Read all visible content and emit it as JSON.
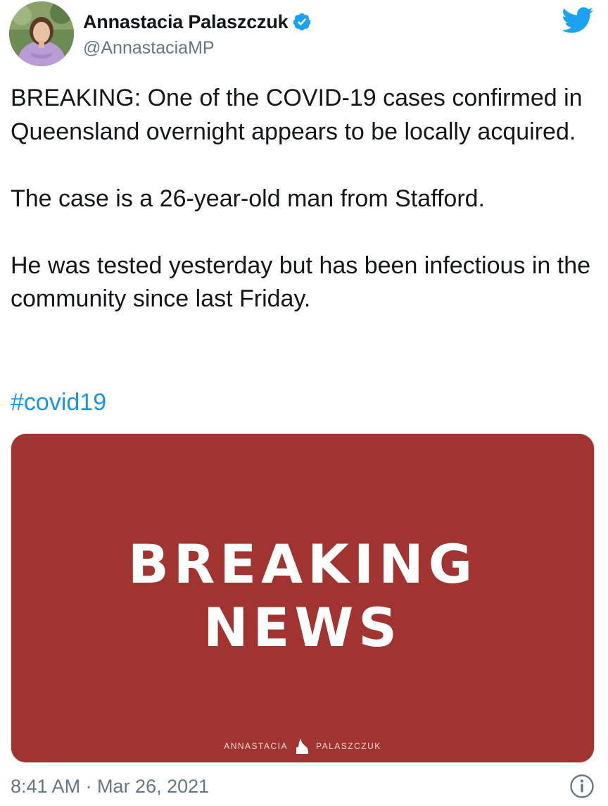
{
  "author": {
    "display_name": "Annastacia Palaszczuk",
    "handle": "@AnnastaciaMP",
    "verified_icon": "verified-badge-icon",
    "avatar_icon": "profile-avatar"
  },
  "platform_icon": "twitter-bird-icon",
  "tweet": {
    "paragraphs": [
      "BREAKING: One of the COVID-19 cases confirmed in Queensland overnight appears to be locally acquired.",
      "The case is a 26-year-old man from Stafford.",
      "He was tested yesterday but has been infectious in the community since last Friday."
    ],
    "hashtag": "#covid19"
  },
  "media": {
    "headline_line1": "BREAKING",
    "headline_line2": "NEWS",
    "signature_first": "ANNASTACIA",
    "signature_last": "PALASZCZUK",
    "background_color": "#a13331"
  },
  "footer": {
    "timestamp": "8:41 AM · Mar 26, 2021",
    "info_icon": "info-icon"
  },
  "colors": {
    "link": "#1b95e0",
    "secondary_text": "#657786",
    "verified": "#1da1f2"
  }
}
